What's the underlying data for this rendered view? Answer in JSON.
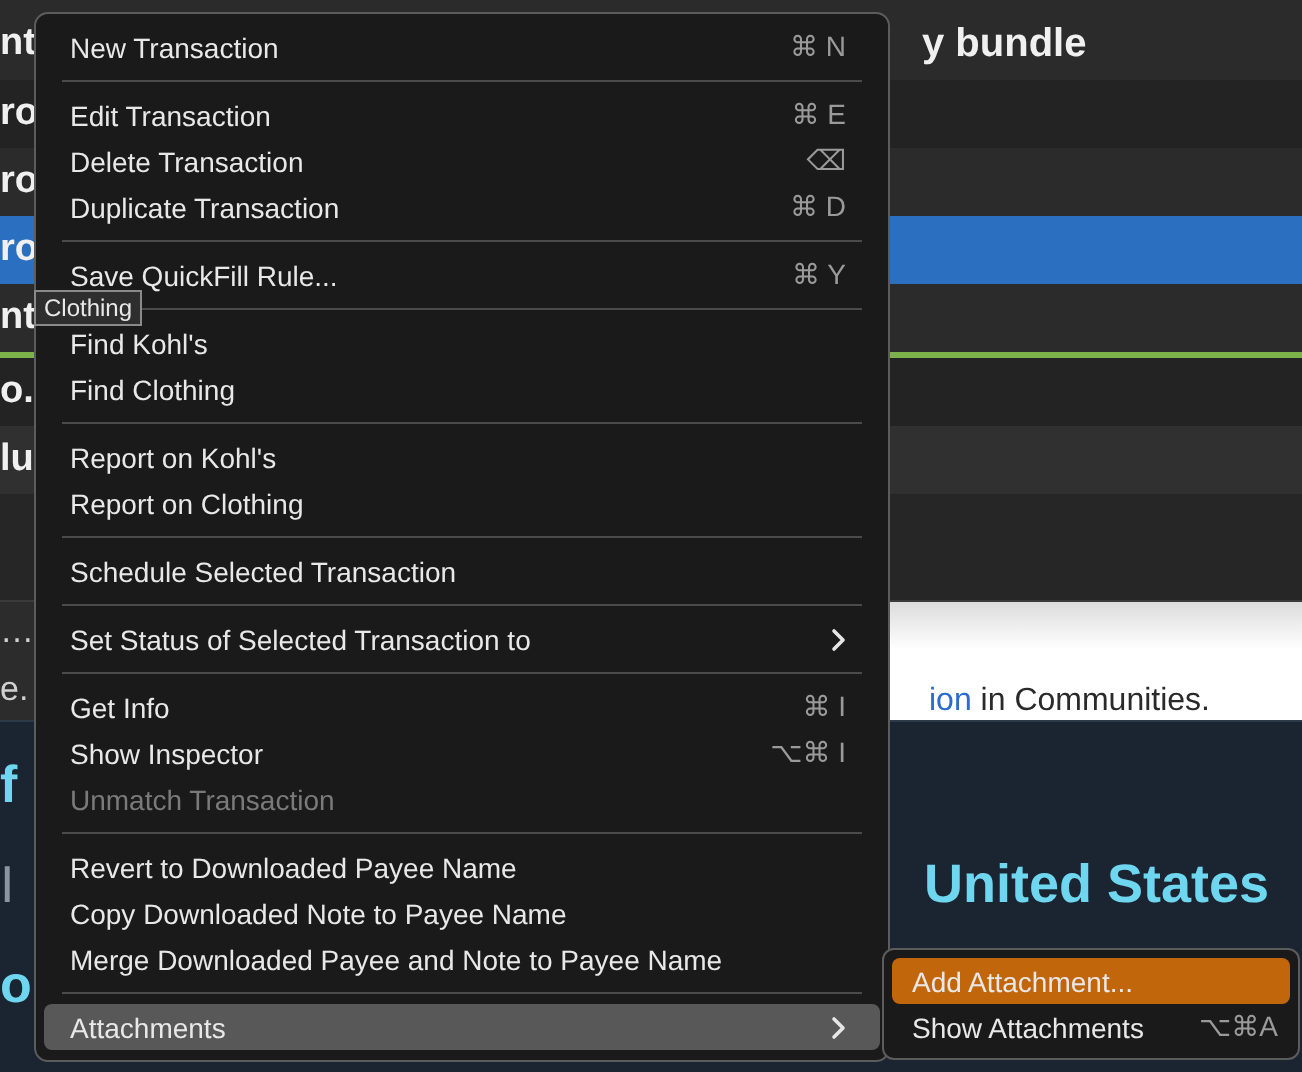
{
  "background": {
    "rows": [
      {
        "left": "nt",
        "right": "y bundle",
        "selected": false
      },
      {
        "left": "ro",
        "right": "",
        "selected": false
      },
      {
        "left": "ro",
        "right": "",
        "selected": false
      },
      {
        "left": "ro",
        "right": "",
        "selected": true
      },
      {
        "left": "nt",
        "right": "",
        "selected": false
      },
      {
        "left": "o.",
        "right": "",
        "selected": false
      },
      {
        "left": "lu",
        "right": "",
        "selected": false
      }
    ],
    "web_snippet": {
      "left_texts": [
        "…",
        "e."
      ],
      "link": "ion",
      "text": "in Communities."
    },
    "lower": {
      "left_texts": [
        {
          "text": "f",
          "kind": "accent"
        },
        {
          "text": "I",
          "kind": "muted"
        },
        {
          "text": "o",
          "kind": "accent"
        }
      ],
      "heading": "United States"
    }
  },
  "context_menu": {
    "items": [
      {
        "kind": "item",
        "label": "New Transaction",
        "shortcut": "⌘ N",
        "disabled": false,
        "selected": false,
        "submenu": false
      },
      {
        "kind": "separator"
      },
      {
        "kind": "item",
        "label": "Edit Transaction",
        "shortcut": "⌘ E",
        "disabled": false,
        "selected": false,
        "submenu": false
      },
      {
        "kind": "item",
        "label": "Delete Transaction",
        "shortcut": "⌫",
        "disabled": false,
        "selected": false,
        "submenu": false
      },
      {
        "kind": "item",
        "label": "Duplicate Transaction",
        "shortcut": "⌘ D",
        "disabled": false,
        "selected": false,
        "submenu": false
      },
      {
        "kind": "separator"
      },
      {
        "kind": "item",
        "label": "Save QuickFill Rule...",
        "shortcut": "⌘ Y",
        "disabled": false,
        "selected": false,
        "submenu": false
      },
      {
        "kind": "separator"
      },
      {
        "kind": "item",
        "label": "Find Kohl's",
        "disabled": false,
        "selected": false,
        "submenu": false
      },
      {
        "kind": "item",
        "label": "Find Clothing",
        "disabled": false,
        "selected": false,
        "submenu": false
      },
      {
        "kind": "separator"
      },
      {
        "kind": "item",
        "label": "Report on Kohl's",
        "disabled": false,
        "selected": false,
        "submenu": false
      },
      {
        "kind": "item",
        "label": "Report on Clothing",
        "disabled": false,
        "selected": false,
        "submenu": false
      },
      {
        "kind": "separator"
      },
      {
        "kind": "item",
        "label": "Schedule Selected Transaction",
        "disabled": false,
        "selected": false,
        "submenu": false
      },
      {
        "kind": "separator"
      },
      {
        "kind": "item",
        "label": "Set Status of Selected Transaction to",
        "disabled": false,
        "selected": false,
        "submenu": true
      },
      {
        "kind": "separator"
      },
      {
        "kind": "item",
        "label": "Get Info",
        "shortcut": "⌘ I",
        "disabled": false,
        "selected": false,
        "submenu": false
      },
      {
        "kind": "item",
        "label": "Show Inspector",
        "shortcut": "⌥⌘ I",
        "disabled": false,
        "selected": false,
        "submenu": false
      },
      {
        "kind": "item",
        "label": "Unmatch Transaction",
        "disabled": true,
        "selected": false,
        "submenu": false
      },
      {
        "kind": "separator"
      },
      {
        "kind": "item",
        "label": "Revert to Downloaded Payee Name",
        "disabled": false,
        "selected": false,
        "submenu": false
      },
      {
        "kind": "item",
        "label": "Copy Downloaded Note to Payee Name",
        "disabled": false,
        "selected": false,
        "submenu": false
      },
      {
        "kind": "item",
        "label": "Merge Downloaded Payee and Note to Payee Name",
        "disabled": false,
        "selected": false,
        "submenu": false
      },
      {
        "kind": "separator"
      },
      {
        "kind": "item",
        "label": "Attachments",
        "disabled": false,
        "selected": true,
        "submenu": true
      }
    ]
  },
  "tooltip": "Clothing",
  "submenu": {
    "items": [
      {
        "label": "Add Attachment...",
        "selected": true
      },
      {
        "label": "Show Attachments",
        "shortcut": "⌥⌘A",
        "selected": false
      }
    ]
  }
}
